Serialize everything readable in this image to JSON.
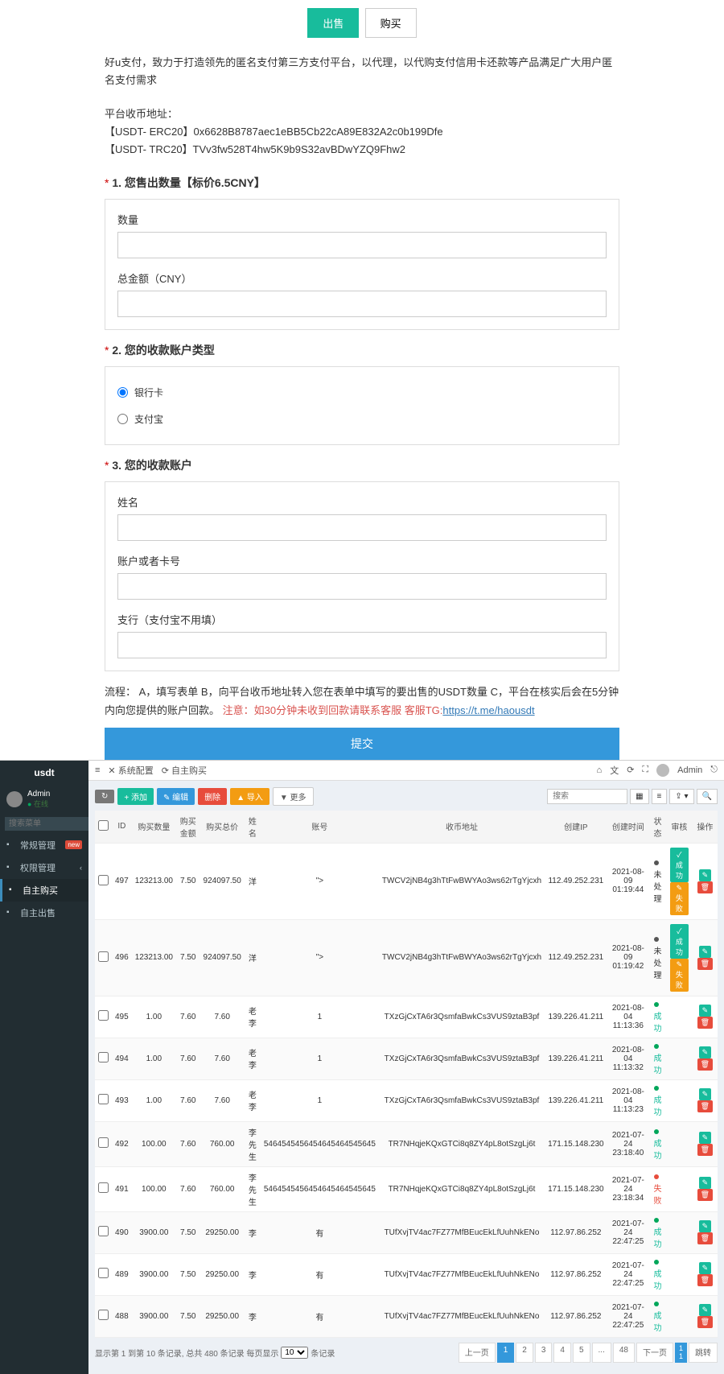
{
  "tabs": {
    "sell": "出售",
    "buy": "购买"
  },
  "intro": "好u支付，致力于打造领先的匿名支付第三方支付平台，以代理，以代购支付信用卡还款等产品满足广大用户匿名支付需求",
  "addr": {
    "title": "平台收币地址：",
    "erc": "【USDT- ERC20】0x6628B8787aec1eBB5Cb22cA89E832A2c0b199Dfe",
    "trc": "【USDT- TRC20】TVv3fw528T4hw5K9b9S32avBDwYZQ9Fhw2"
  },
  "s1": {
    "title": "1. 您售出数量【标价6.5CNY】",
    "qty": "数量",
    "total": "总金额（CNY）"
  },
  "s2": {
    "title": "2. 您的收款账户类型",
    "bank": "银行卡",
    "alipay": "支付宝"
  },
  "s3": {
    "title": "3. 您的收款账户",
    "name": "姓名",
    "acct": "账户或者卡号",
    "branch": "支行（支付宝不用填）"
  },
  "process": {
    "pre": "流程：  A，填写表单 B，向平台收币地址转入您在表单中填写的要出售的USDT数量 C，平台在核实后会在5分钟内向您提供的账户回款。",
    "warn": "注意：如30分钟未收到回款请联系客服 客服TG:",
    "link": "https://t.me/haousdt"
  },
  "submit": "提交",
  "admin": {
    "brand": "usdt",
    "user": {
      "name": "Admin",
      "status": "在线"
    },
    "search_ph": "搜索菜单",
    "nav": [
      {
        "label": "常规管理",
        "badge": "new"
      },
      {
        "label": "权限管理",
        "chev": true
      },
      {
        "label": "自主购买",
        "active": true
      },
      {
        "label": "自主出售"
      }
    ],
    "topbar": {
      "l": [
        "≡",
        "✕ 系统配置",
        "⟳ 自主购买"
      ],
      "r_user": "Admin"
    },
    "tools": {
      "refresh": "↻",
      "add": "+ 添加",
      "edit": "✎ 编辑",
      "del": "删除",
      "import": "▲ 导入",
      "more": "▼ 更多",
      "search_ph": "搜索"
    },
    "cols": [
      "",
      "ID",
      "购买数量",
      "购买金额",
      "购买总价",
      "姓名",
      "账号",
      "收币地址",
      "创建IP",
      "创建时间",
      "状态",
      "审核",
      "操作"
    ],
    "rows": [
      {
        "id": "497",
        "qty": "123213.00",
        "amt": "7.50",
        "total": "924097.50",
        "name": "洋",
        "acct": "&quot;&gt;",
        "addr": "TWCV2jNB4g3hTtFwBWYAo3ws62rTgYjcxh",
        "ip": "112.49.252.231",
        "time": "2021-08-09 01:19:44",
        "status": "未处理",
        "sd": "gray",
        "audit": [
          "成功",
          "失败"
        ]
      },
      {
        "id": "496",
        "qty": "123213.00",
        "amt": "7.50",
        "total": "924097.50",
        "name": "洋",
        "acct": "&quot;&gt;",
        "addr": "TWCV2jNB4g3hTtFwBWYAo3ws62rTgYjcxh",
        "ip": "112.49.252.231",
        "time": "2021-08-09 01:19:42",
        "status": "未处理",
        "sd": "gray",
        "audit": [
          "成功",
          "失败"
        ]
      },
      {
        "id": "495",
        "qty": "1.00",
        "amt": "7.60",
        "total": "7.60",
        "name": "老李",
        "acct": "1",
        "addr": "TXzGjCxTA6r3QsmfaBwkCs3VUS9ztaB3pf",
        "ip": "139.226.41.211",
        "time": "2021-08-04 11:13:36",
        "status": "成功",
        "sd": "green"
      },
      {
        "id": "494",
        "qty": "1.00",
        "amt": "7.60",
        "total": "7.60",
        "name": "老李",
        "acct": "1",
        "addr": "TXzGjCxTA6r3QsmfaBwkCs3VUS9ztaB3pf",
        "ip": "139.226.41.211",
        "time": "2021-08-04 11:13:32",
        "status": "成功",
        "sd": "green"
      },
      {
        "id": "493",
        "qty": "1.00",
        "amt": "7.60",
        "total": "7.60",
        "name": "老李",
        "acct": "1",
        "addr": "TXzGjCxTA6r3QsmfaBwkCs3VUS9ztaB3pf",
        "ip": "139.226.41.211",
        "time": "2021-08-04 11:13:23",
        "status": "成功",
        "sd": "green"
      },
      {
        "id": "492",
        "qty": "100.00",
        "amt": "7.60",
        "total": "760.00",
        "name": "李先生",
        "acct": "5464545456454645464545645",
        "addr": "TR7NHqjeKQxGTCi8q8ZY4pL8otSzgLj6t",
        "ip": "171.15.148.230",
        "time": "2021-07-24 23:18:40",
        "status": "成功",
        "sd": "green"
      },
      {
        "id": "491",
        "qty": "100.00",
        "amt": "7.60",
        "total": "760.00",
        "name": "李先生",
        "acct": "5464545456454645464545645",
        "addr": "TR7NHqjeKQxGTCi8q8ZY4pL8otSzgLj6t",
        "ip": "171.15.148.230",
        "time": "2021-07-24 23:18:34",
        "status": "失败",
        "sd": "red"
      },
      {
        "id": "490",
        "qty": "3900.00",
        "amt": "7.50",
        "total": "29250.00",
        "name": "李",
        "acct": "有",
        "addr": "TUfXvjTV4ac7FZ77MfBEucEkLfUuhNkENo",
        "ip": "112.97.86.252",
        "time": "2021-07-24 22:47:25",
        "status": "成功",
        "sd": "green"
      },
      {
        "id": "489",
        "qty": "3900.00",
        "amt": "7.50",
        "total": "29250.00",
        "name": "李",
        "acct": "有",
        "addr": "TUfXvjTV4ac7FZ77MfBEucEkLfUuhNkENo",
        "ip": "112.97.86.252",
        "time": "2021-07-24 22:47:25",
        "status": "成功",
        "sd": "green"
      },
      {
        "id": "488",
        "qty": "3900.00",
        "amt": "7.50",
        "total": "29250.00",
        "name": "李",
        "acct": "有",
        "addr": "TUfXvjTV4ac7FZ77MfBEucEkLfUuhNkENo",
        "ip": "112.97.86.252",
        "time": "2021-07-24 22:47:25",
        "status": "成功",
        "sd": "green"
      }
    ],
    "pager": {
      "info_a": "显示第 1 到第 10 条记录, 总共 480 条记录 每页显示",
      "info_b": "条记录",
      "sel": "10",
      "prev": "上一页",
      "next": "下一页",
      "jump": "跳转",
      "pages": [
        "1",
        "2",
        "3",
        "4",
        "5",
        "...",
        "48"
      ]
    }
  }
}
